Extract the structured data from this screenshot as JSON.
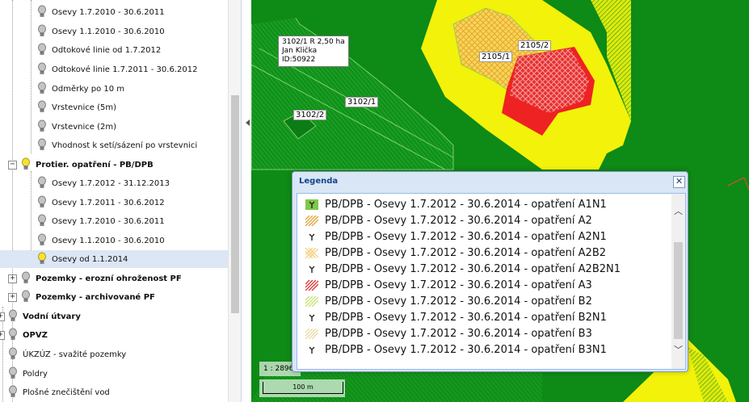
{
  "tree": {
    "items": [
      {
        "label": "Osevy 1.7.2010 - 30.6.2011",
        "bulb": "grey"
      },
      {
        "label": "Osevy 1.1.2010 - 30.6.2010",
        "bulb": "grey"
      },
      {
        "label": "Odtokové linie od 1.7.2012",
        "bulb": "grey"
      },
      {
        "label": "Odtokové linie 1.7.2011 - 30.6.2012",
        "bulb": "grey"
      },
      {
        "label": "Odměrky po 10 m",
        "bulb": "grey"
      },
      {
        "label": "Vrstevnice (5m)",
        "bulb": "grey"
      },
      {
        "label": "Vrstevnice (2m)",
        "bulb": "grey"
      },
      {
        "label": "Vhodnost k setí/sázení po vrstevnici",
        "bulb": "grey"
      },
      {
        "label": "Protier. opatření - PB/DPB",
        "bulb": "yellow",
        "toggle": "−"
      },
      {
        "label": "Osevy 1.7.2012 - 31.12.2013",
        "bulb": "grey"
      },
      {
        "label": "Osevy 1.7.2011 - 30.6.2012",
        "bulb": "grey"
      },
      {
        "label": "Osevy 1.7.2010 - 30.6.2011",
        "bulb": "grey"
      },
      {
        "label": "Osevy 1.1.2010 - 30.6.2010",
        "bulb": "grey"
      },
      {
        "label": "Osevy od 1.1.2014",
        "bulb": "yellow"
      },
      {
        "label": "Pozemky - erozní ohroženost PF",
        "bulb": "grey",
        "toggle": "+"
      },
      {
        "label": "Pozemky - archivované PF",
        "bulb": "grey",
        "toggle": "+"
      },
      {
        "label": "Vodní útvary",
        "bulb": "grey",
        "toggle": "+"
      },
      {
        "label": "OPVZ",
        "bulb": "grey",
        "toggle": "+"
      },
      {
        "label": "ÚKZÚZ - svažité pozemky",
        "bulb": "grey"
      },
      {
        "label": "Poldry",
        "bulb": "grey"
      },
      {
        "label": "Plošné znečištění vod",
        "bulb": "grey"
      }
    ]
  },
  "map": {
    "parcel_info": {
      "line1": "3102/1 R 2,50 ha",
      "line2": "Jan Klička",
      "line3": "ID:50922"
    },
    "labels": [
      "2105/2",
      "2105/1",
      "3102/1",
      "3102/2"
    ],
    "colors": {
      "base": "#0e8a16",
      "yellow": "#f2f20a",
      "red": "#ee2222",
      "orange": "#f5c430"
    },
    "scale_ratio": "1 : 2896",
    "scale_bar": "100 m"
  },
  "legend": {
    "title": "Legenda",
    "close_icon": "close-icon",
    "items": [
      {
        "label": "PB/DPB - Osevy 1.7.2012 - 30.6.2014 - opatření A1N1",
        "swatch": "plant-green"
      },
      {
        "label": "PB/DPB - Osevy 1.7.2012 - 30.6.2014 - opatření A2",
        "swatch": "hatch-orange"
      },
      {
        "label": "PB/DPB - Osevy 1.7.2012 - 30.6.2014 - opatření A2N1",
        "swatch": "plant-white"
      },
      {
        "label": "PB/DPB - Osevy 1.7.2012 - 30.6.2014 - opatření A2B2",
        "swatch": "cross-orange"
      },
      {
        "label": "PB/DPB - Osevy 1.7.2012 - 30.6.2014 - opatření A2B2N1",
        "swatch": "plant-white"
      },
      {
        "label": "PB/DPB - Osevy 1.7.2012 - 30.6.2014 - opatření A3",
        "swatch": "hatch-red"
      },
      {
        "label": "PB/DPB - Osevy 1.7.2012 - 30.6.2014 - opatření B2",
        "swatch": "hatch-yellowgreen"
      },
      {
        "label": "PB/DPB - Osevy 1.7.2012 - 30.6.2014 - opatření B2N1",
        "swatch": "plant-white"
      },
      {
        "label": "PB/DPB - Osevy 1.7.2012 - 30.6.2014 - opatření B3",
        "swatch": "hatch-beige"
      },
      {
        "label": "PB/DPB - Osevy 1.7.2012 - 30.6.2014 - opatření B3N1",
        "swatch": "plant-white"
      }
    ]
  }
}
